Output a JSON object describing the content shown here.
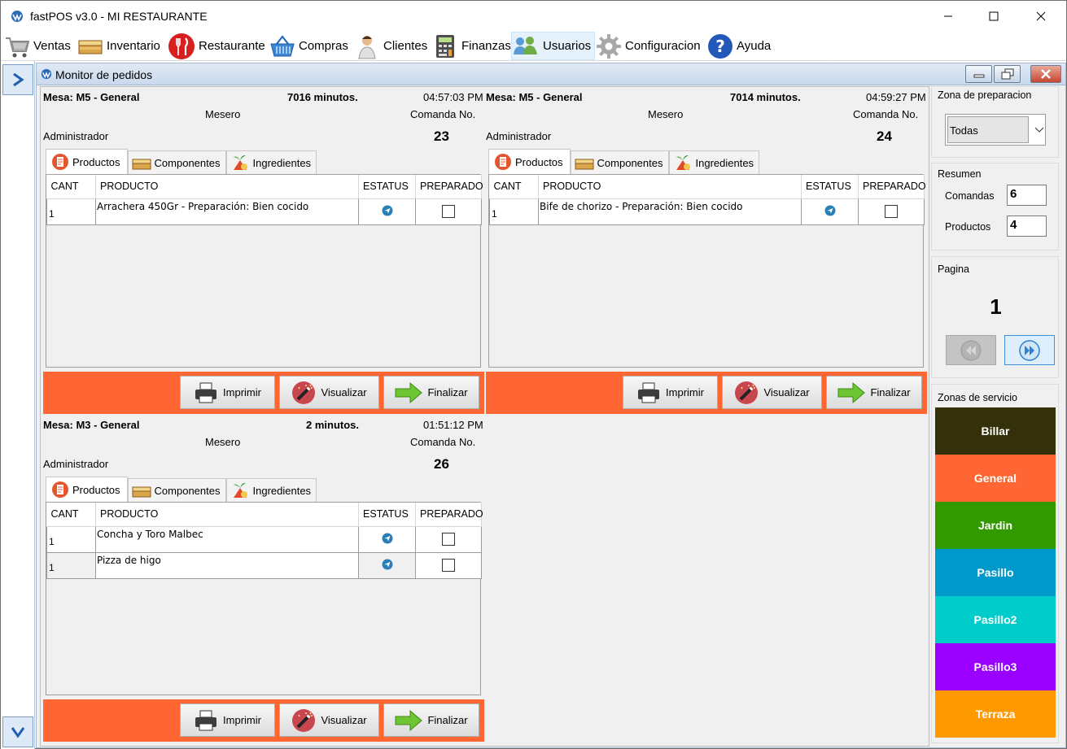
{
  "window": {
    "title": "fastPOS v3.0 - MI RESTAURANTE"
  },
  "menu": [
    {
      "label": "Ventas",
      "icon": "cart-icon"
    },
    {
      "label": "Inventario",
      "icon": "box-icon"
    },
    {
      "label": "Restaurante",
      "icon": "cutlery-icon"
    },
    {
      "label": "Compras",
      "icon": "basket-icon"
    },
    {
      "label": "Clientes",
      "icon": "person-icon"
    },
    {
      "label": "Finanzas",
      "icon": "calculator-icon"
    },
    {
      "label": "Usuarios",
      "icon": "users-icon"
    },
    {
      "label": "Configuracion",
      "icon": "gear-icon"
    },
    {
      "label": "Ayuda",
      "icon": "help-icon"
    }
  ],
  "monitor": {
    "title": "Monitor de pedidos"
  },
  "labels": {
    "mesero": "Mesero",
    "comanda_no": "Comanda No.",
    "tab_productos": "Productos",
    "tab_componentes": "Componentes",
    "tab_ingredientes": "Ingredientes",
    "col_cant": "CANT",
    "col_producto": "PRODUCTO",
    "col_estatus": "ESTATUS",
    "col_preparado": "PREPARADO",
    "btn_imprimir": "Imprimir",
    "btn_visualizar": "Visualizar",
    "btn_finalizar": "Finalizar"
  },
  "orders": [
    {
      "mesa": "Mesa: M5 - General",
      "minutos": "7016 minutos.",
      "hora": "04:57:03 PM",
      "mesero": "Administrador",
      "comanda": "23",
      "items": [
        {
          "cant": "1",
          "producto": "Arrachera 450Gr - Preparación: Bien cocido",
          "preparado": false
        }
      ]
    },
    {
      "mesa": "Mesa: M5 - General",
      "minutos": "7014 minutos.",
      "hora": "04:59:27 PM",
      "mesero": "Administrador",
      "comanda": "24",
      "items": [
        {
          "cant": "1",
          "producto": "Bife de chorizo - Preparación: Bien cocido",
          "preparado": false
        }
      ]
    },
    {
      "mesa": "Mesa: M3 - General",
      "minutos": "2 minutos.",
      "hora": "01:51:12 PM",
      "mesero": "Administrador",
      "comanda": "26",
      "items": [
        {
          "cant": "1",
          "producto": "Concha y Toro Malbec",
          "preparado": false
        },
        {
          "cant": "1",
          "producto": "Pizza de higo",
          "preparado": false
        }
      ]
    }
  ],
  "sidebar": {
    "zona_label": "Zona de preparacion",
    "zona_value": "Todas",
    "resumen_label": "Resumen",
    "comandas_label": "Comandas",
    "comandas_value": "6",
    "productos_label": "Productos",
    "productos_value": "4",
    "pagina_label": "Pagina",
    "pagina_value": "1",
    "zonas_label": "Zonas de servicio",
    "zonas": [
      {
        "label": "Billar",
        "color": "#33300a"
      },
      {
        "label": "General",
        "color": "#ff6633"
      },
      {
        "label": "Jardin",
        "color": "#339900"
      },
      {
        "label": "Pasillo",
        "color": "#0099cc"
      },
      {
        "label": "Pasillo2",
        "color": "#00cccc"
      },
      {
        "label": "Pasillo3",
        "color": "#9900ff"
      },
      {
        "label": "Terraza",
        "color": "#ff9900"
      }
    ]
  }
}
